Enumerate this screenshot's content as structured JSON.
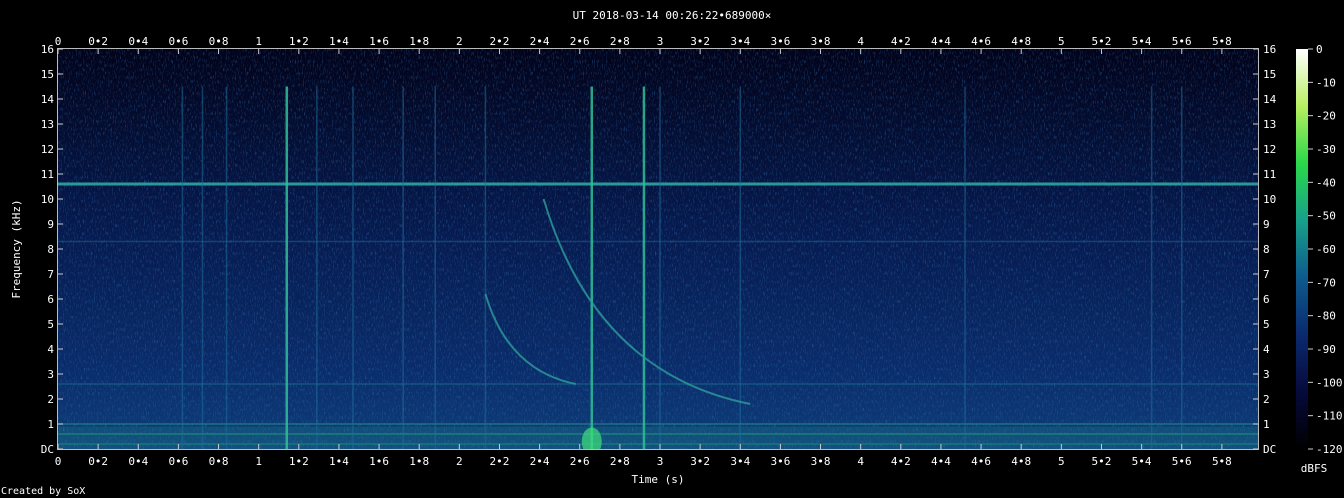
{
  "chart_data": {
    "type": "heatmap",
    "title": "UT 2018-03-14 00:26:22•689000×",
    "xlabel": "Time (s)",
    "ylabel": "Frequency (kHz)",
    "credit": "Created by SoX",
    "xlim": [
      0,
      5.98
    ],
    "ylim": [
      0,
      16
    ],
    "x_ticks": [
      "0",
      "0•2",
      "0•4",
      "0•6",
      "0•8",
      "1",
      "1•2",
      "1•4",
      "1•6",
      "1•8",
      "2",
      "2•2",
      "2•4",
      "2•6",
      "2•8",
      "3",
      "3•2",
      "3•4",
      "3•6",
      "3•8",
      "4",
      "4•2",
      "4•4",
      "4•6",
      "4•8",
      "5",
      "5•2",
      "5•4",
      "5•6",
      "5•8"
    ],
    "y_ticks": [
      "DC",
      "1",
      "2",
      "3",
      "4",
      "5",
      "6",
      "7",
      "8",
      "9",
      "10",
      "11",
      "12",
      "13",
      "14",
      "15",
      "16"
    ],
    "colorbar": {
      "label": "dBFS",
      "ticks": [
        "0",
        "-10",
        "-20",
        "-30",
        "-40",
        "-50",
        "-60",
        "-70",
        "-80",
        "-90",
        "-100",
        "-110",
        "-120"
      ],
      "range": [
        -120,
        0
      ],
      "colors": [
        "#000000",
        "#060a3c",
        "#0a2a6e",
        "#0e5a8c",
        "#17a08a",
        "#2ad84a",
        "#b8f060",
        "#ffffff"
      ]
    },
    "features": {
      "horizontal_lines_khz": [
        10.6,
        8.3,
        2.6,
        1.0,
        0.6,
        0.2
      ],
      "vertical_bursts_s": [
        0.62,
        0.72,
        0.84,
        1.14,
        1.29,
        1.47,
        1.72,
        1.88,
        2.13,
        2.66,
        2.92,
        3.0,
        3.4,
        4.52,
        5.45,
        5.6
      ],
      "whistler_tones": [
        {
          "start_s": 2.42,
          "start_khz": 10.0,
          "end_s": 3.45,
          "end_khz": 1.8
        },
        {
          "start_s": 2.13,
          "start_khz": 6.2,
          "end_s": 2.58,
          "end_khz": 2.6
        }
      ]
    }
  }
}
